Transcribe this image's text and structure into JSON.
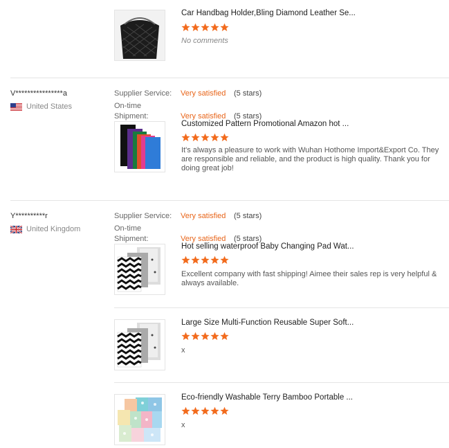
{
  "reviews": [
    {
      "products": [
        {
          "title": "Car Handbag Holder,Bling Diamond Leather Se...",
          "comment": "No comments",
          "rating": 5
        }
      ]
    },
    {
      "reviewer": "V****************a",
      "country": "United States",
      "supplier_service_label": "Supplier Service:",
      "supplier_service_value": "Very satisfied",
      "supplier_service_stars": "(5 stars)",
      "ontime_label_1": "On-time",
      "ontime_label_2": "Shipment:",
      "ontime_value": "Very satisfied",
      "ontime_stars": "(5 stars)",
      "products": [
        {
          "title": "Customized Pattern Promotional Amazon hot ...",
          "comment": "It's always a pleasure to work with Wuhan Hothome Import&Export Co. They are responsible and reliable, and the product is high quality. Thank you for doing great job!",
          "rating": 5
        }
      ]
    },
    {
      "reviewer": "Y**********r",
      "country": "United Kingdom",
      "supplier_service_label": "Supplier Service:",
      "supplier_service_value": "Very satisfied",
      "supplier_service_stars": "(5 stars)",
      "ontime_label_1": "On-time",
      "ontime_label_2": "Shipment:",
      "ontime_value": "Very satisfied",
      "ontime_stars": "(5 stars)",
      "products": [
        {
          "title": "Hot selling waterproof Baby Changing Pad Wat...",
          "comment": "Excellent company with fast shipping! Aimee their sales rep is very helpful & always available.",
          "rating": 5
        },
        {
          "title": "Large Size Multi-Function Reusable Super Soft...",
          "comment": "x",
          "rating": 5
        },
        {
          "title": "Eco-friendly Washable Terry Bamboo Portable ...",
          "comment": "x",
          "rating": 5
        }
      ]
    }
  ],
  "colors": {
    "star": "#f26b1d",
    "accent": "#e8651a",
    "separator": "#e5e5e5"
  }
}
